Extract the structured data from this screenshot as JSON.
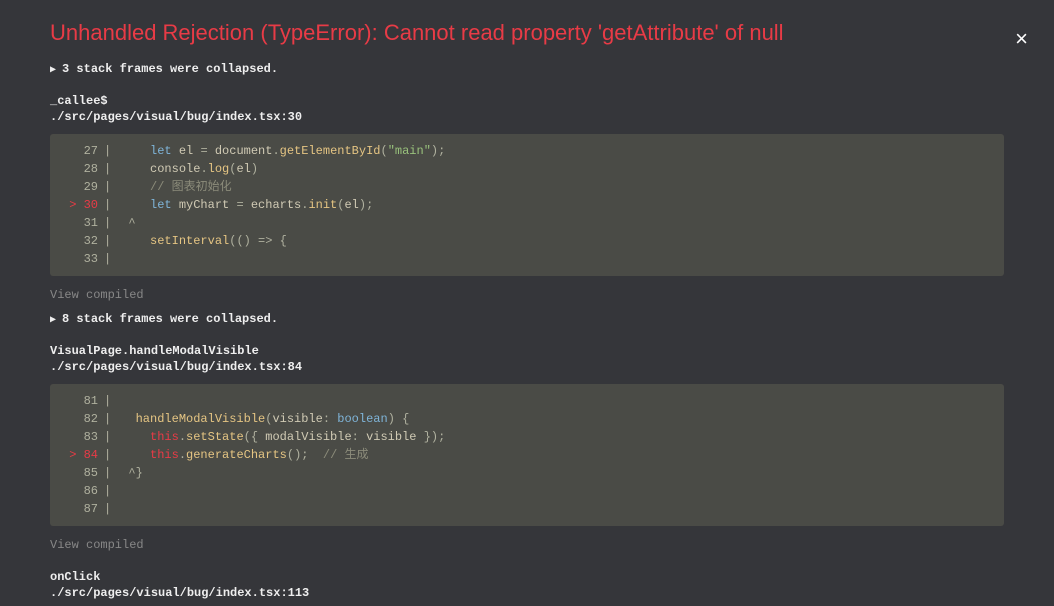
{
  "error": {
    "title": "Unhandled Rejection (TypeError): Cannot read property 'getAttribute' of null",
    "close_label": "×"
  },
  "collapsed1": "3 stack frames were collapsed.",
  "collapsed2": "8 stack frames were collapsed.",
  "frame1": {
    "fn": "_callee$",
    "src": "./src/pages/visual/bug/index.tsx:30",
    "view_compiled": "View compiled"
  },
  "frame2": {
    "fn": "VisualPage.handleModalVisible",
    "src": "./src/pages/visual/bug/index.tsx:84",
    "view_compiled": "View compiled"
  },
  "frame3": {
    "fn": "onClick",
    "src": "./src/pages/visual/bug/index.tsx:113"
  },
  "code1": {
    "l27_num": "  27",
    "l28_num": "  28",
    "l29_num": "  29",
    "l30_num": "> 30",
    "l31_num": "  31",
    "l32_num": "  32",
    "l33_num": "  33",
    "kw_let1": "let",
    "var_el": " el ",
    "op_eq1": "=",
    "obj_doc": " document",
    "dot1": ".",
    "fn_getid": "getElementById",
    "paren_o1": "(",
    "str_main": "\"main\"",
    "paren_c1": ")",
    "semi1": ";",
    "obj_console": "console",
    "dot2": ".",
    "fn_log": "log",
    "paren_o2": "(",
    "var_el2": "el",
    "paren_c2": ")",
    "comment29": "// 图表初始化",
    "kw_let2": "let",
    "var_mychart": " myChart ",
    "op_eq2": "=",
    "obj_echarts": " echarts",
    "dot3": ".",
    "fn_init": "init",
    "paren_o3": "(",
    "var_el3": "el",
    "paren_c3": ")",
    "semi3": ";",
    "caret31": "^",
    "fn_setint": "setInterval",
    "paren_o4": "(",
    "arrow_params": "()",
    "arrow": " => ",
    "brace_o": "{"
  },
  "code2": {
    "l81_num": "  81",
    "l82_num": "  82",
    "l83_num": "  83",
    "l84_num": "> 84",
    "l85_num": "  85",
    "l86_num": "  86",
    "l87_num": "  87",
    "fn_handle": "handleModalVisible",
    "paren_o1": "(",
    "param_vis": "visible",
    "colon1": ": ",
    "type_bool": "boolean",
    "paren_c1": ")",
    "brace_o1": " {",
    "this1": "this",
    "dot1": ".",
    "fn_setstate": "setState",
    "paren_o2": "(",
    "brace_o2": "{ ",
    "key_modal": "modalVisible",
    "colon2": ": ",
    "val_vis": "visible",
    "brace_c2": " }",
    "paren_c2": ")",
    "semi1": ";",
    "this2": "this",
    "dot2": ".",
    "fn_gen": "generateCharts",
    "paren_o3": "(",
    "paren_c3": ")",
    "semi2": ";",
    "comment84": "  // 生成",
    "caret85": "^",
    "brace_c1": "}"
  }
}
